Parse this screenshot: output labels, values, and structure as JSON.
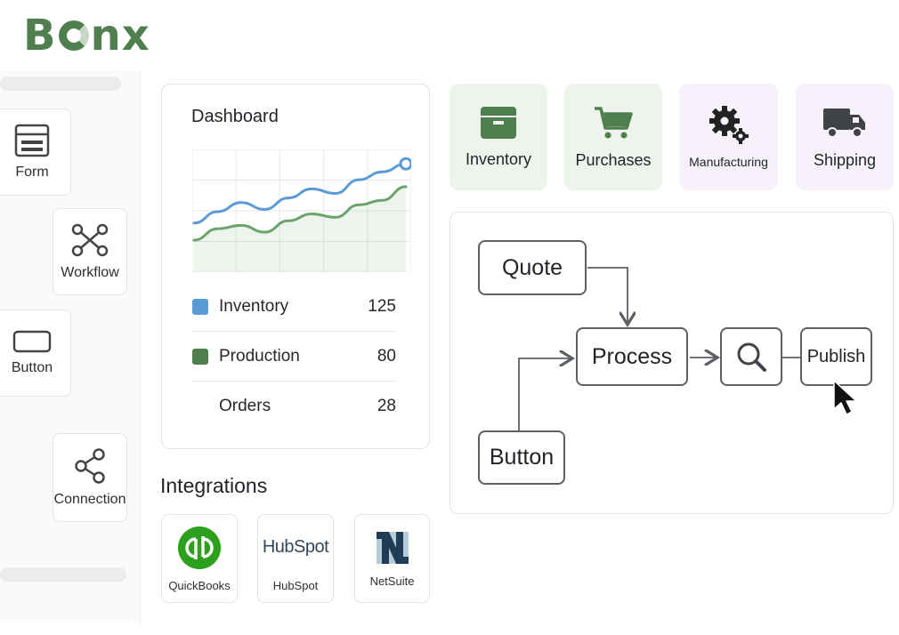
{
  "brand": {
    "name_left": "B",
    "name_right": "nx",
    "color": "#4f7f4e"
  },
  "sidebar": {
    "components": [
      {
        "label": "Form",
        "icon": "form-icon"
      },
      {
        "label": "Workflow",
        "icon": "workflow-icon"
      },
      {
        "label": "Button",
        "icon": "button-icon"
      },
      {
        "label": "Connection",
        "icon": "share-icon"
      }
    ]
  },
  "dashboard": {
    "title": "Dashboard",
    "chart_data": {
      "type": "line",
      "series": [
        {
          "name": "Inventory",
          "color": "#5b9bd5",
          "values": [
            40,
            50,
            58,
            52,
            62,
            70,
            66,
            78,
            85,
            92
          ]
        },
        {
          "name": "Production",
          "color": "#6aa46a",
          "values": [
            25,
            35,
            38,
            32,
            42,
            48,
            45,
            56,
            60,
            72
          ]
        }
      ],
      "ylim": [
        0,
        100
      ],
      "grid": true
    },
    "legend": [
      {
        "label": "Inventory",
        "value": "125",
        "color": "#5b9bd5"
      },
      {
        "label": "Production",
        "value": "80",
        "color": "#4f7f4e"
      },
      {
        "label": "Orders",
        "value": "28",
        "color": ""
      }
    ]
  },
  "integrations": {
    "title": "Integrations",
    "items": [
      {
        "label": "QuickBooks",
        "logo": "qb",
        "color": "#2ca01c"
      },
      {
        "label": "HubSpot",
        "logo_text": "HubSpot",
        "color": "#ff7a59"
      },
      {
        "label": "NetSuite",
        "logo": "N"
      }
    ]
  },
  "modules": [
    {
      "label": "Inventory",
      "icon": "box-icon",
      "tone": "green"
    },
    {
      "label": "Purchases",
      "icon": "cart-icon",
      "tone": "green"
    },
    {
      "label": "Manufacturing",
      "icon": "gears-icon",
      "tone": "purple"
    },
    {
      "label": "Shipping",
      "icon": "truck-icon",
      "tone": "purple"
    }
  ],
  "flow": {
    "nodes": {
      "quote": "Quote",
      "process": "Process",
      "button": "Button",
      "publish": "Publish"
    },
    "search_icon": "search-icon"
  }
}
